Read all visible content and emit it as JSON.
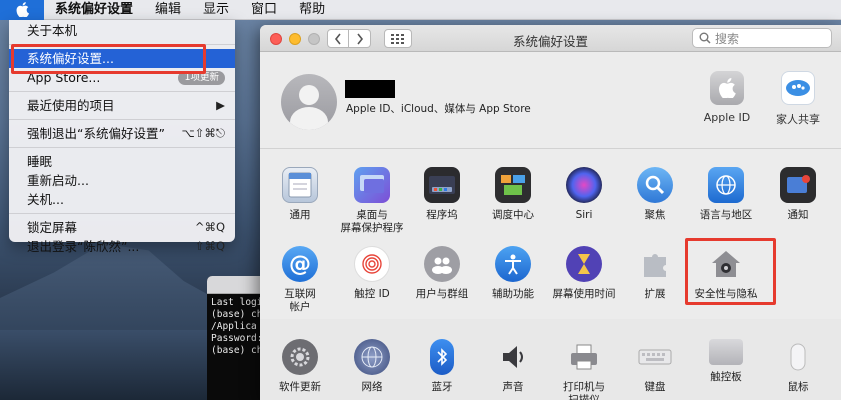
{
  "menubar": {
    "items": [
      "系统偏好设置",
      "编辑",
      "显示",
      "窗口",
      "帮助"
    ]
  },
  "apple_menu": {
    "items": [
      {
        "label": "关于本机",
        "shortcut": ""
      },
      {
        "label": "系统偏好设置...",
        "shortcut": ""
      },
      {
        "label": "App Store...",
        "shortcut": "1项更新"
      },
      {
        "label": "最近使用的项目",
        "shortcut": "▶"
      },
      {
        "label": "强制退出“系统偏好设置”",
        "shortcut": "⌥⇧⌘⎋"
      },
      {
        "label": "睡眠",
        "shortcut": ""
      },
      {
        "label": "重新启动...",
        "shortcut": ""
      },
      {
        "label": "关机...",
        "shortcut": ""
      },
      {
        "label": "锁定屏幕",
        "shortcut": "^⌘Q"
      },
      {
        "label": "退出登录“陈欣然”...",
        "shortcut": "⇧⌘Q"
      }
    ]
  },
  "terminal": {
    "lines": [
      "Last logi",
      "(base) che",
      " /Applica",
      "Password:",
      "(base) che"
    ]
  },
  "prefs": {
    "title": "系统偏好设置",
    "search_placeholder": "搜索",
    "user_subtitle": "Apple ID、iCloud、媒体与 App Store",
    "apple_id_label": "Apple ID",
    "family_label": "家人共享",
    "row1": [
      "通用",
      "桌面与\n屏幕保护程序",
      "程序坞",
      "调度中心",
      "Siri",
      "聚焦",
      "语言与地区",
      "通知"
    ],
    "row2": [
      "互联网\n帐户",
      "触控 ID",
      "用户与群组",
      "辅助功能",
      "屏幕使用时间",
      "扩展",
      "安全性与隐私"
    ],
    "row3": [
      "软件更新",
      "网络",
      "蓝牙",
      "声音",
      "打印机与\n扫描仪",
      "键盘",
      "触控板",
      "鼠标"
    ]
  },
  "colors": {
    "selection_blue": "#2462d6",
    "highlight_red": "#e63a2e"
  }
}
